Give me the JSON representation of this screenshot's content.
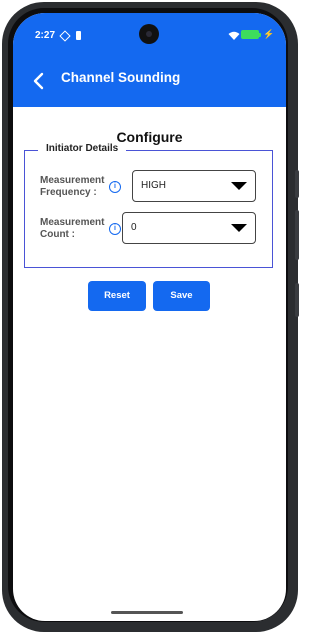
{
  "status": {
    "time": "2:27",
    "icon_diamond": "diamond-icon",
    "icon_battery_small": "battery-small-icon",
    "wifi": "wifi-icon",
    "battery": "battery-icon",
    "charging": "charging-bolt-icon",
    "charging_glyph": "⚡"
  },
  "appbar": {
    "title": "Channel Sounding",
    "back_icon": "back-arrow-icon"
  },
  "page": {
    "title": "Configure"
  },
  "initiator": {
    "legend": "Initiator Details",
    "frequency": {
      "label": "Measurement Frequency :",
      "info": "i",
      "value": "HIGH"
    },
    "count": {
      "label": "Measurement Count :",
      "info": "i",
      "value": "0"
    }
  },
  "buttons": {
    "reset": "Reset",
    "save": "Save"
  },
  "colors": {
    "accent": "#1469f0",
    "fieldset_border": "#4a53d6",
    "battery": "#3ddc5c"
  }
}
